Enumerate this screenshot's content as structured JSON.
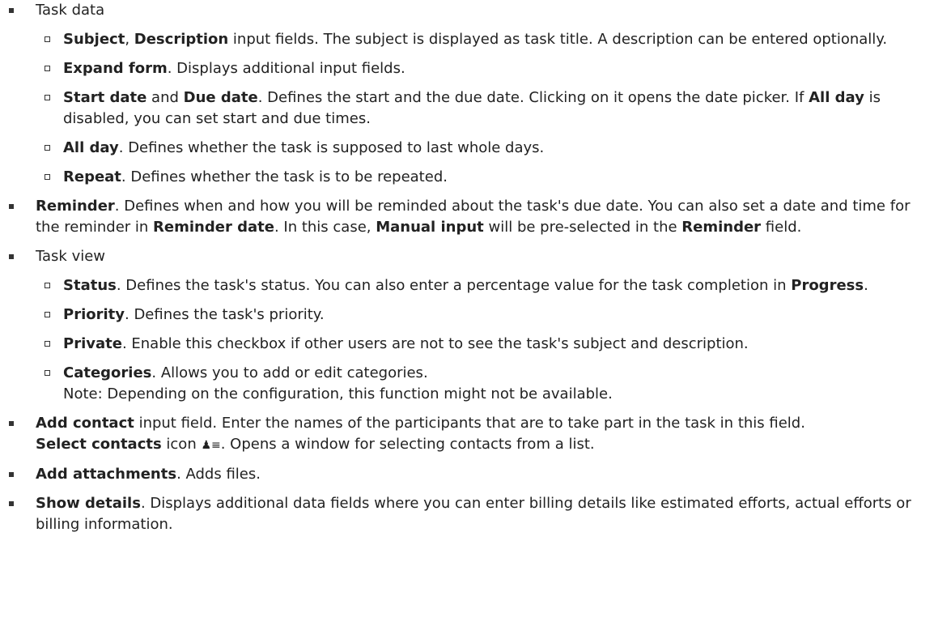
{
  "list": {
    "task_data": {
      "label": "Task data",
      "items": [
        {
          "terms": [
            "Subject",
            "Description"
          ],
          "sep": ", ",
          "text": " input fields. The subject is displayed as task title. A description can be entered optionally."
        },
        {
          "term": "Expand form",
          "text": ". Displays additional input fields."
        },
        {
          "term1": "Start date",
          "mid": " and ",
          "term2": "Due date",
          "text": ". Defines the start and the due date. Clicking on it opens the date picker. If ",
          "term3": "All day",
          "text2": " is disabled, you can set start and due times."
        },
        {
          "term": "All day",
          "text": ". Defines whether the task is supposed to last whole days."
        },
        {
          "term": "Repeat",
          "text": ". Defines whether the task is to be repeated."
        }
      ]
    },
    "reminder": {
      "term": "Reminder",
      "text": ". Defines when and how you will be reminded about the task's due date. You can also set a date and time for the reminder in ",
      "term2": "Reminder date",
      "text2": ". In this case, ",
      "term3": "Manual input",
      "text3": " will be pre-selected in the ",
      "term4": "Reminder",
      "text4": " field."
    },
    "task_view": {
      "label": "Task view",
      "items": [
        {
          "term": "Status",
          "text": ". Defines the task's status. You can also enter a percentage value for the task completion in ",
          "term2": "Progress",
          "text2": "."
        },
        {
          "term": "Priority",
          "text": ". Defines the task's priority."
        },
        {
          "term": "Private",
          "text": ". Enable this checkbox if other users are not to see the task's subject and description."
        },
        {
          "term": "Categories",
          "text": ". Allows you to add or edit categories.",
          "note": "Note: Depending on the configuration, this function might not be available."
        }
      ]
    },
    "add_contact": {
      "term": "Add contact",
      "text": " input field. Enter the names of the participants that are to take part in the task in this field.",
      "term2": "Select contacts",
      "text2": " icon ",
      "icon": "contacts-icon",
      "icon_glyph": "♟≡",
      "text3": ". Opens a window for selecting contacts from a list."
    },
    "add_attachments": {
      "term": "Add attachments",
      "text": ". Adds files."
    },
    "show_details": {
      "term": "Show details",
      "text": ". Displays additional data fields where you can enter billing details like estimated efforts, actual efforts or billing information."
    }
  }
}
